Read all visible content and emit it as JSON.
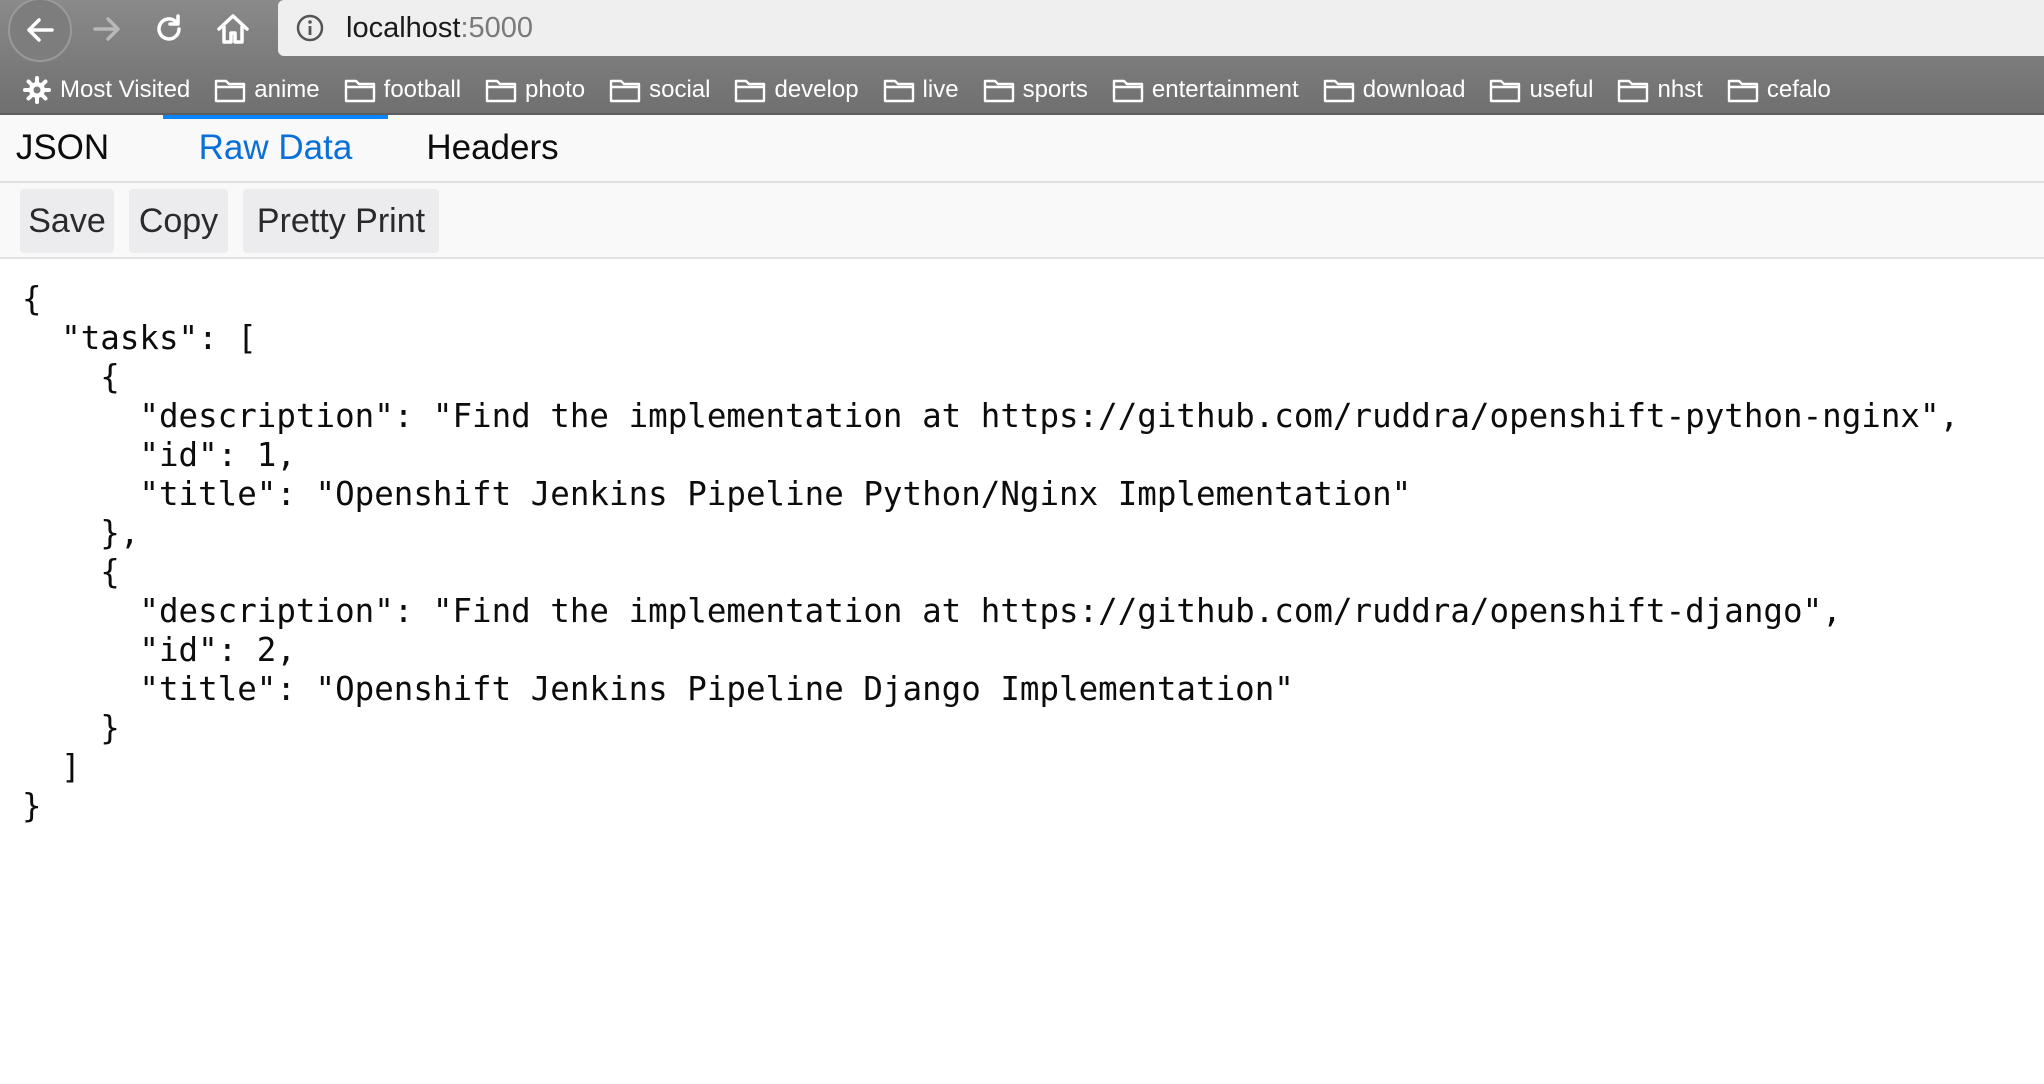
{
  "browser": {
    "url_host": "localhost",
    "url_port": ":5000",
    "nav_icons": [
      "back-arrow-icon",
      "forward-arrow-icon",
      "reload-icon",
      "home-icon"
    ],
    "bookmarks_bar": {
      "most_visited_label": "Most Visited",
      "folders": [
        "anime",
        "football",
        "photo",
        "social",
        "develop",
        "live",
        "sports",
        "entertainment",
        "download",
        "useful",
        "nhst",
        "cefalo"
      ]
    }
  },
  "viewer": {
    "tabs": [
      {
        "label": "JSON",
        "active": false
      },
      {
        "label": "Raw Data",
        "active": true
      },
      {
        "label": "Headers",
        "active": false
      }
    ],
    "toolbar": {
      "save_label": "Save",
      "copy_label": "Copy",
      "pretty_print_label": "Pretty Print"
    },
    "raw_lines": [
      "{",
      "  \"tasks\": [",
      "    {",
      "      \"description\": \"Find the implementation at https://github.com/ruddra/openshift-python-nginx\",",
      "      \"id\": 1,",
      "      \"title\": \"Openshift Jenkins Pipeline Python/Nginx Implementation\"",
      "    },",
      "    {",
      "      \"description\": \"Find the implementation at https://github.com/ruddra/openshift-django\",",
      "      \"id\": 2,",
      "      \"title\": \"Openshift Jenkins Pipeline Django Implementation\"",
      "    }",
      "  ]",
      "}"
    ]
  },
  "colors": {
    "chrome_gray": "#7a7a7a",
    "active_tab_blue": "#0a84ff",
    "active_tab_text": "#0a6fd8"
  }
}
